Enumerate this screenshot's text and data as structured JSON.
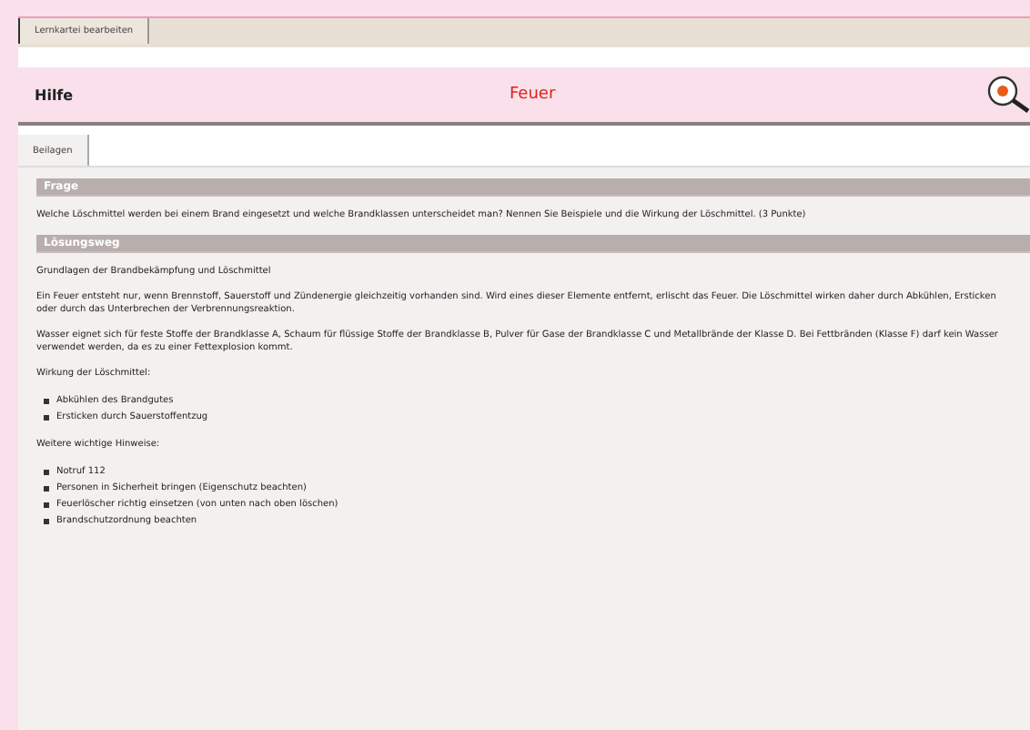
{
  "top_tabs": [
    {
      "label": "Lernkartei bearbeiten",
      "selected": true
    }
  ],
  "header": {
    "left": "Hilfe",
    "title": "Feuer"
  },
  "content_tabs": [
    {
      "label": "Beilagen",
      "selected": true
    }
  ],
  "sections": [
    {
      "heading": "Frage",
      "blocks": [
        {
          "kind": "paragraph",
          "text": "Welche Löschmittel werden bei einem Brand eingesetzt und welche Brandklassen unterscheidet man? Nennen Sie Beispiele und die Wirkung der Löschmittel. (3 Punkte)"
        }
      ]
    },
    {
      "heading": "Lösungsweg",
      "blocks": [
        {
          "kind": "paragraph",
          "text": "Grundlagen der Brandbekämpfung und Löschmittel"
        },
        {
          "kind": "paragraph",
          "text": "Ein Feuer entsteht nur, wenn Brennstoff, Sauerstoff und Zündenergie gleichzeitig vorhanden sind. Wird eines dieser Elemente entfernt, erlischt das Feuer. Die Löschmittel wirken daher durch Abkühlen, Ersticken oder durch das Unterbrechen der Verbrennungsreaktion."
        },
        {
          "kind": "paragraph",
          "text": "Wasser eignet sich für feste Stoffe der Brandklasse A, Schaum für flüssige Stoffe der Brandklasse B, Pulver für Gase der Brandklasse C und Metallbrände der Klasse D. Bei Fettbränden (Klasse F) darf kein Wasser verwendet werden, da es zu einer Fettexplosion kommt."
        },
        {
          "kind": "paragraph",
          "text": "Wirkung der Löschmittel:"
        },
        {
          "kind": "list",
          "items": [
            "Abkühlen des Brandgutes",
            "Ersticken durch Sauerstoffentzug"
          ]
        },
        {
          "kind": "paragraph",
          "text": "Weitere wichtige Hinweise:"
        },
        {
          "kind": "list",
          "items": [
            "Notruf 112",
            "Personen in Sicherheit bringen (Eigenschutz beachten)",
            "Feuerlöscher richtig einsetzen (von unten nach oben löschen)",
            "Brandschutzordnung beachten"
          ]
        }
      ]
    }
  ]
}
